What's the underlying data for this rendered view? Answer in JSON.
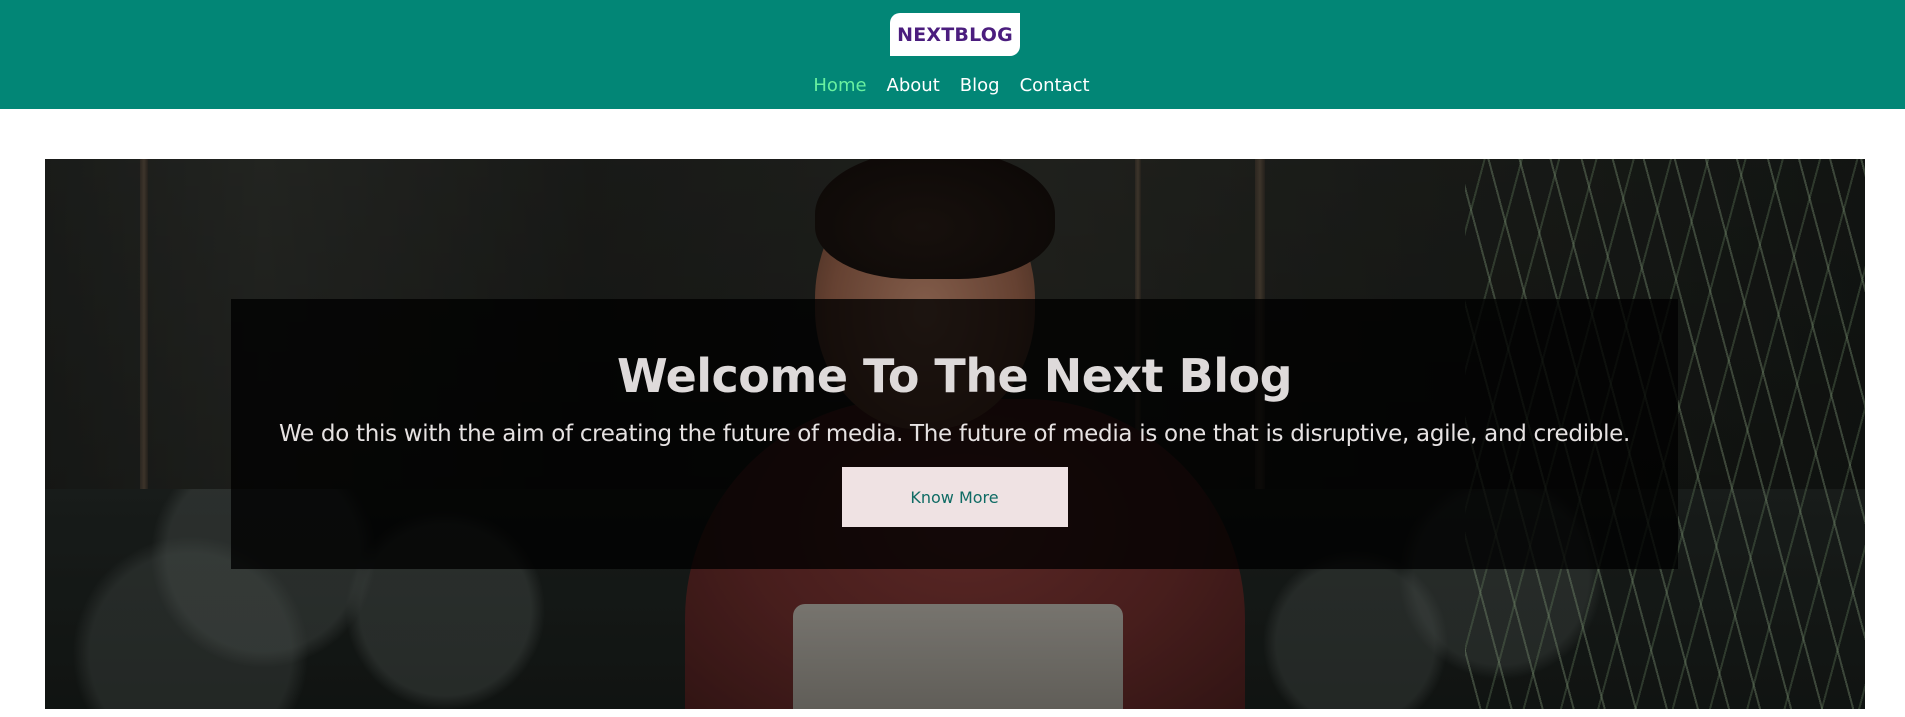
{
  "header": {
    "logo_text": "NEXTBLOG",
    "nav": [
      {
        "label": "Home",
        "active": true
      },
      {
        "label": "About",
        "active": false
      },
      {
        "label": "Blog",
        "active": false
      },
      {
        "label": "Contact",
        "active": false
      }
    ]
  },
  "hero": {
    "title": "Welcome To The Next Blog",
    "subtitle": "We do this with the aim of creating the future of media. The future of media is one that is disruptive, agile, and credible.",
    "button_label": "Know More"
  },
  "colors": {
    "header_bg": "#028676",
    "logo_text": "#4b1d7e",
    "nav_active": "#69f0a0",
    "button_bg": "#efe2e3",
    "button_text": "#0f6b64"
  }
}
